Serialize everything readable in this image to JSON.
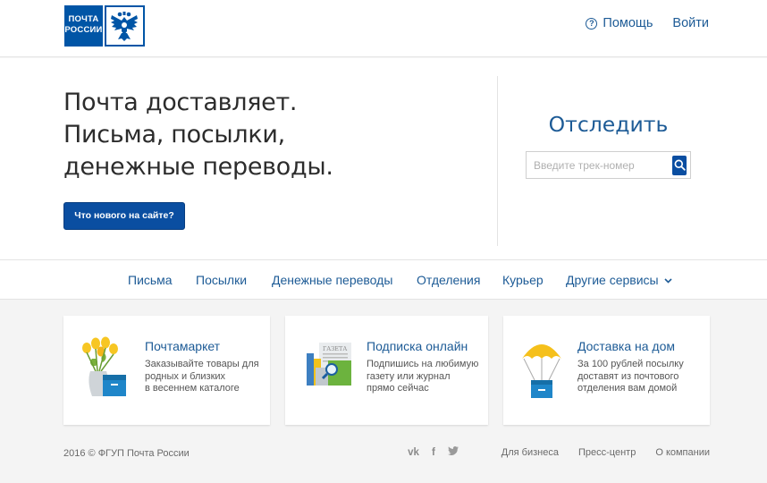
{
  "header": {
    "logo_line1": "ПОЧТА",
    "logo_line2": "РОССИИ",
    "help_label": "Помощь",
    "login_label": "Войти",
    "brand_color": "#0055a6"
  },
  "hero": {
    "title_line1": "Почта доставляет.",
    "title_line2": "Письма, посылки,",
    "title_line3": "денежные переводы.",
    "button_label": "Что нового на сайте?",
    "track_title": "Отследить",
    "track_placeholder": "Введите трек-номер"
  },
  "nav": {
    "items": [
      "Письма",
      "Посылки",
      "Денежные переводы",
      "Отделения",
      "Курьер",
      "Другие сервисы"
    ]
  },
  "cards": [
    {
      "title": "Почтамаркет",
      "desc": [
        "Заказывайте товары для",
        "родных и близких",
        "в весеннем каталоге"
      ],
      "icon": "flowers-box-icon"
    },
    {
      "title": "Подписка онлайн",
      "desc": [
        "Подпишись на любимую",
        "газету или журнал",
        "прямо сейчас"
      ],
      "icon": "newspaper-icon"
    },
    {
      "title": "Доставка на дом",
      "desc": [
        "За 100 рублей посылку",
        "доставят из почтового",
        "отделения вам домой"
      ],
      "icon": "parachute-box-icon"
    }
  ],
  "footer": {
    "copyright": "2016 © ФГУП Почта России",
    "social": [
      "vk-icon",
      "facebook-icon",
      "twitter-icon"
    ],
    "links": [
      "Для бизнеса",
      "Пресс-центр",
      "О компании"
    ]
  },
  "colors": {
    "link": "#1d5b96",
    "button": "#0a4ea1",
    "background": "#f4f4f4"
  }
}
